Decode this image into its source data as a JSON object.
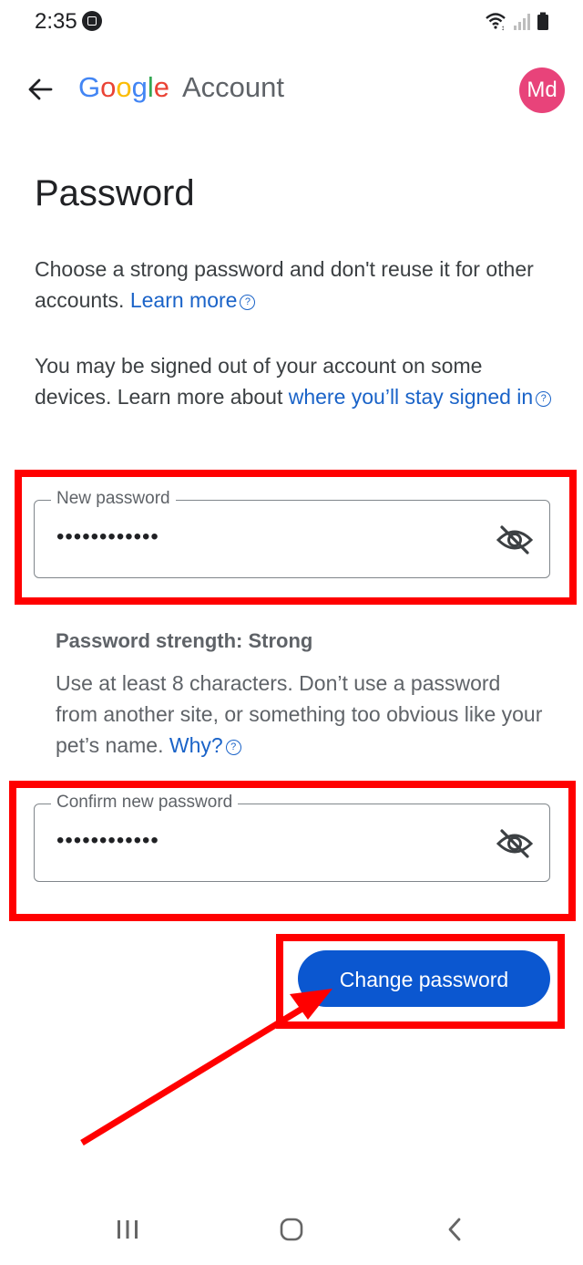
{
  "status_bar": {
    "time": "2:35"
  },
  "app_bar": {
    "logo_letters": [
      {
        "ch": "G",
        "color": "#4285F4"
      },
      {
        "ch": "o",
        "color": "#EA4335"
      },
      {
        "ch": "o",
        "color": "#FBBC05"
      },
      {
        "ch": "g",
        "color": "#4285F4"
      },
      {
        "ch": "l",
        "color": "#34A853"
      },
      {
        "ch": "e",
        "color": "#EA4335"
      }
    ],
    "account_word": "Account",
    "avatar_initials": "Md",
    "avatar_color": "#e8437a"
  },
  "page": {
    "title": "Password",
    "para1_text": "Choose a strong password and don't reuse it for other accounts. ",
    "para1_link": "Learn more",
    "para2_text": "You may be signed out of your account on some devices. Learn more about ",
    "para2_link": "where you’ll stay signed in",
    "help_icon": "?"
  },
  "fields": {
    "new_password": {
      "label": "New password",
      "value": "••••••••••••"
    },
    "confirm_password": {
      "label": "Confirm new password",
      "value": "••••••••••••"
    }
  },
  "strength": {
    "label": "Password strength: Strong",
    "help_text": "Use at least 8 characters. Don’t use a password from another site, or something too obvious like your pet’s name. ",
    "help_link": "Why?"
  },
  "actions": {
    "change_password_label": "Change password"
  },
  "colors": {
    "accent": "#0b57d0",
    "link": "#1a63c8",
    "highlight": "#ff0000"
  }
}
